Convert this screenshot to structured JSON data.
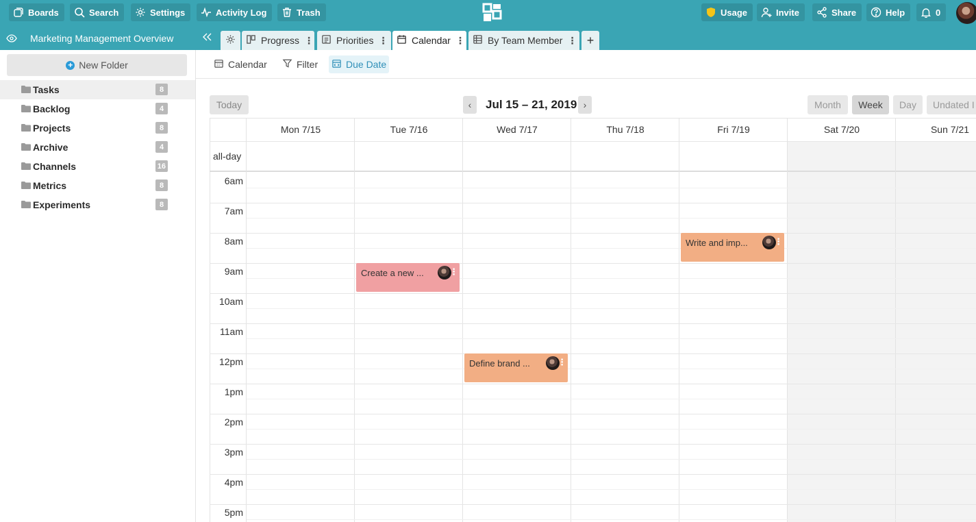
{
  "topbar": {
    "boards": "Boards",
    "search": "Search",
    "settings": "Settings",
    "activity_log": "Activity Log",
    "trash": "Trash",
    "usage": "Usage",
    "invite": "Invite",
    "share": "Share",
    "help": "Help",
    "notifications_count": "0"
  },
  "tabbar": {
    "board_title": "Marketing Management Overview",
    "tabs": [
      {
        "label": "Progress",
        "icon": "progress-icon"
      },
      {
        "label": "Priorities",
        "icon": "list-icon"
      },
      {
        "label": "Calendar",
        "icon": "calendar-icon",
        "active": true
      },
      {
        "label": "By Team Member",
        "icon": "table-icon"
      }
    ]
  },
  "sidebar": {
    "new_folder": "New Folder",
    "folders": [
      {
        "label": "Tasks",
        "count": "8",
        "selected": true
      },
      {
        "label": "Backlog",
        "count": "4"
      },
      {
        "label": "Projects",
        "count": "8"
      },
      {
        "label": "Archive",
        "count": "4"
      },
      {
        "label": "Channels",
        "count": "16"
      },
      {
        "label": "Metrics",
        "count": "8"
      },
      {
        "label": "Experiments",
        "count": "8"
      }
    ]
  },
  "viewbar": {
    "calendar": "Calendar",
    "filter": "Filter",
    "due_date": "Due Date"
  },
  "calendar": {
    "today": "Today",
    "range": "Jul 15 – 21, 2019",
    "views": [
      "Month",
      "Week",
      "Day",
      "Undated I"
    ],
    "active_view": "Week",
    "days": [
      "Mon 7/15",
      "Tue 7/16",
      "Wed 7/17",
      "Thu 7/18",
      "Fri 7/19",
      "Sat 7/20",
      "Sun 7/21"
    ],
    "all_day": "all-day",
    "hours": [
      "6am",
      "7am",
      "8am",
      "9am",
      "10am",
      "11am",
      "12pm",
      "1pm",
      "2pm",
      "3pm",
      "4pm",
      "5pm"
    ],
    "events": [
      {
        "title": "Create a new ...",
        "day": "Tue 7/16",
        "time": "9am",
        "color": "#f0a0a2"
      },
      {
        "title": "Define brand ...",
        "day": "Wed 7/17",
        "time": "12pm",
        "color": "#f2ae84"
      },
      {
        "title": "Write and imp...",
        "day": "Fri 7/19",
        "time": "8am",
        "color": "#f2ae84"
      }
    ]
  },
  "colors": {
    "brand": "#3aa5b4",
    "usage_icon": "#f5c518",
    "new_folder_icon": "#2b9bd8"
  }
}
